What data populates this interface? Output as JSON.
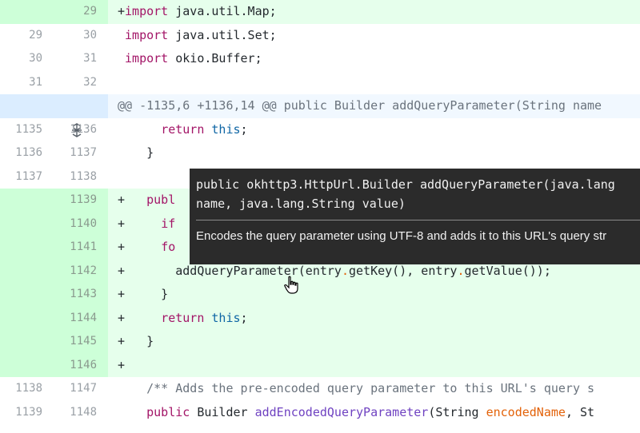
{
  "hunk_header": "@@ -1135,6 +1136,14 @@ public Builder addQueryParameter(String name",
  "expand_icon": "expand-icon",
  "rows": [
    {
      "type": "add",
      "old": "",
      "new": "29",
      "code": "+import java.util.Map;"
    },
    {
      "type": "ctx",
      "old": "29",
      "new": "30",
      "code": " import java.util.Set;"
    },
    {
      "type": "ctx",
      "old": "30",
      "new": "31",
      "code": " import okio.Buffer;"
    },
    {
      "type": "ctx",
      "old": "31",
      "new": "32",
      "code": ""
    },
    {
      "type": "ctx",
      "old": "1135",
      "new": "1136",
      "code": "      return this;"
    },
    {
      "type": "ctx",
      "old": "1136",
      "new": "1137",
      "code": "    }"
    },
    {
      "type": "ctx",
      "old": "1137",
      "new": "1138",
      "code": ""
    },
    {
      "type": "add",
      "old": "",
      "new": "1139",
      "code": "+   publ"
    },
    {
      "type": "add",
      "old": "",
      "new": "1140",
      "code": "+     if"
    },
    {
      "type": "add",
      "old": "",
      "new": "1141",
      "code": "+     fo"
    },
    {
      "type": "add",
      "old": "",
      "new": "1142",
      "code": "+       addQueryParameter(entry.getKey(), entry.getValue());"
    },
    {
      "type": "add",
      "old": "",
      "new": "1143",
      "code": "+     }"
    },
    {
      "type": "add",
      "old": "",
      "new": "1144",
      "code": "+     return this;"
    },
    {
      "type": "add",
      "old": "",
      "new": "1145",
      "code": "+   }"
    },
    {
      "type": "add",
      "old": "",
      "new": "1146",
      "code": "+"
    },
    {
      "type": "ctx",
      "old": "1138",
      "new": "1147",
      "code": "    /** Adds the pre-encoded query parameter to this URL's query s"
    },
    {
      "type": "ctx",
      "old": "1139",
      "new": "1148",
      "code": "    public Builder addEncodedQueryParameter(String encodedName, St"
    }
  ],
  "tooltip": {
    "signature_line1": "public okhttp3.HttpUrl.Builder addQueryParameter(java.lang",
    "signature_line2": "name, java.lang.String value)",
    "doc": "Encodes the query parameter using UTF-8 and adds it to this URL's query str"
  },
  "colors": {
    "added_bg": "#e6ffec",
    "added_gutter": "#cdffd8",
    "hunk_bg": "#f1f8ff",
    "tooltip_bg": "#2b2b2b",
    "keyword": "#a31567"
  }
}
